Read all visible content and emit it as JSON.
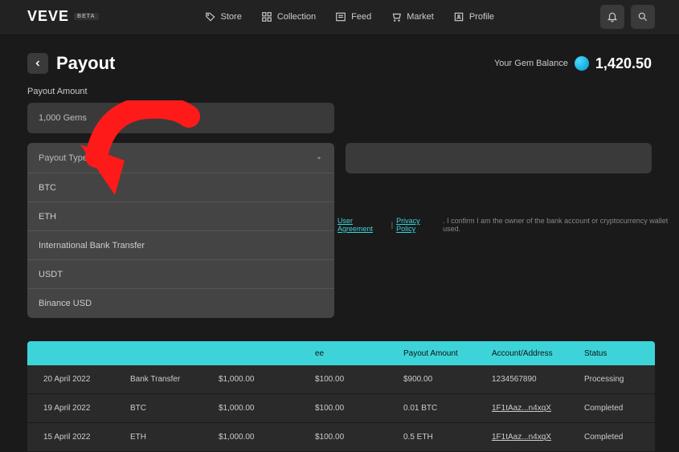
{
  "header": {
    "logo": "VEVE",
    "beta": "BETA",
    "nav": [
      {
        "label": "Store"
      },
      {
        "label": "Collection"
      },
      {
        "label": "Feed"
      },
      {
        "label": "Market"
      },
      {
        "label": "Profile"
      }
    ]
  },
  "page": {
    "title": "Payout",
    "balance_label": "Your Gem Balance",
    "balance_amount": "1,420.50"
  },
  "form": {
    "amount_label": "Payout Amount",
    "amount_value": "1,000 Gems",
    "type_placeholder": "Payout Type...",
    "options": [
      "BTC",
      "ETH",
      "International Bank Transfer",
      "USDT",
      "Binance USD"
    ]
  },
  "consent": {
    "user_agreement": "User Agreement",
    "separator": "|",
    "privacy_policy": "Privacy Policy",
    "suffix": ". I confirm I am the owner of the bank account or cryptocurrency wallet used."
  },
  "table": {
    "headers": {
      "fee": "ee",
      "payout": "Payout Amount",
      "account": "Account/Address",
      "status": "Status"
    },
    "rows": [
      {
        "date": "20 April 2022",
        "type": "Bank Transfer",
        "amount": "$1,000.00",
        "fee": "$100.00",
        "payout": "$900.00",
        "account": "1234567890",
        "status": "Processing",
        "acc_link": false
      },
      {
        "date": "19 April 2022",
        "type": "BTC",
        "amount": "$1,000.00",
        "fee": "$100.00",
        "payout": "0.01 BTC",
        "account": "1F1tAaz...n4xqX",
        "status": "Completed",
        "acc_link": true
      },
      {
        "date": "15 April 2022",
        "type": "ETH",
        "amount": "$1,000.00",
        "fee": "$100.00",
        "payout": "0.5 ETH",
        "account": "1F1tAaz...n4xqX",
        "status": "Completed",
        "acc_link": true
      }
    ]
  }
}
